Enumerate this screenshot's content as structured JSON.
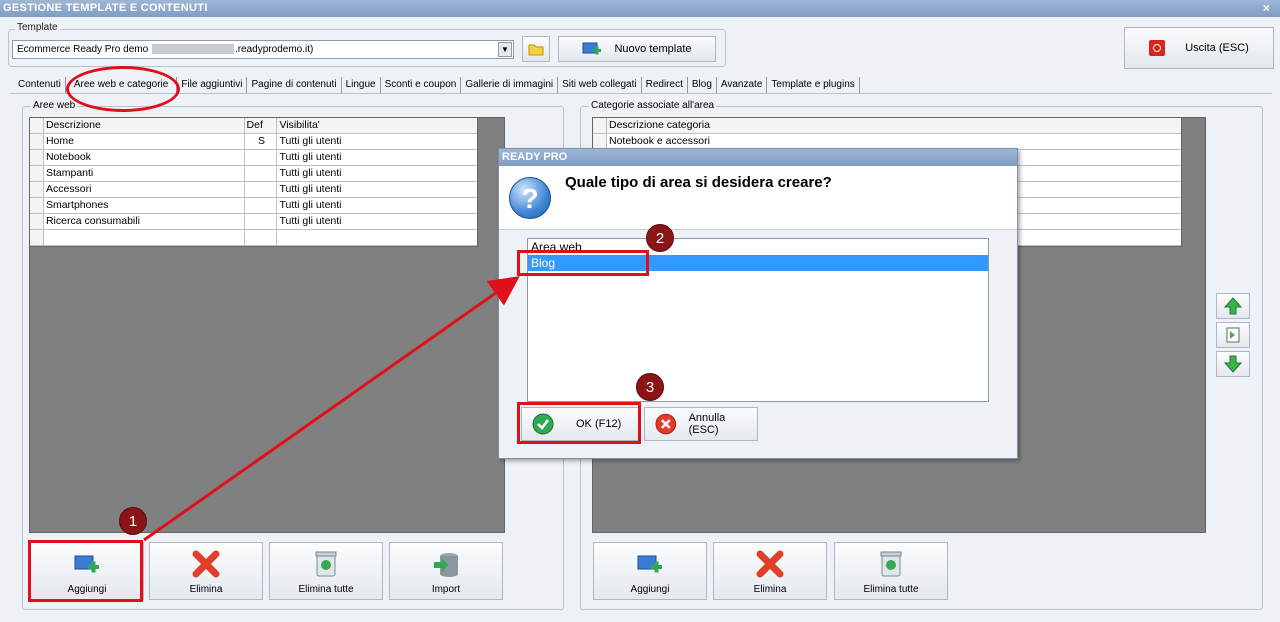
{
  "window": {
    "title": "GESTIONE TEMPLATE E CONTENUTI",
    "close_glyph": "×"
  },
  "template": {
    "legend": "Template",
    "combo_prefix": "Ecommerce Ready Pro demo",
    "combo_suffix": ".readyprodemo.it)",
    "new_label": "Nuovo template"
  },
  "exit_label": "Uscita (ESC)",
  "tabs": [
    {
      "label": "Contenuti"
    },
    {
      "label": "Aree web e categorie",
      "active": true
    },
    {
      "label": "File aggiuntivi"
    },
    {
      "label": "Pagine di contenuti"
    },
    {
      "label": "Lingue"
    },
    {
      "label": "Sconti e coupon"
    },
    {
      "label": "Gallerie di immagini"
    },
    {
      "label": "Siti web collegati"
    },
    {
      "label": "Redirect"
    },
    {
      "label": "Blog"
    },
    {
      "label": "Avanzate"
    },
    {
      "label": "Template e plugins"
    }
  ],
  "left_panel": {
    "legend": "Aree web",
    "columns": [
      "Descrizione",
      "Def",
      "Visibilita'"
    ],
    "rows": [
      [
        "Home",
        "S",
        "Tutti gli utenti"
      ],
      [
        "Notebook",
        "",
        "Tutti gli utenti"
      ],
      [
        "Stampanti",
        "",
        "Tutti gli utenti"
      ],
      [
        "Accessori",
        "",
        "Tutti gli utenti"
      ],
      [
        "Smartphones",
        "",
        "Tutti gli utenti"
      ],
      [
        "Ricerca consumabili",
        "",
        "Tutti gli utenti"
      ],
      [
        "",
        "",
        ""
      ]
    ],
    "buttons": {
      "add": "Aggiungi",
      "delete": "Elimina",
      "delete_all": "Elimina tutte",
      "import": "Import"
    }
  },
  "right_panel": {
    "legend": "Categorie associate all'area",
    "columns": [
      "Descrizione categoria"
    ],
    "rows": [
      [
        "Notebook e accessori"
      ]
    ],
    "buttons": {
      "add": "Aggiungi",
      "delete": "Elimina",
      "delete_all": "Elimina tutte"
    }
  },
  "dialog": {
    "title": "READY PRO",
    "question": "Quale tipo di area si desidera creare?",
    "options": [
      "Area web",
      "Blog"
    ],
    "selected": "Blog",
    "ok_label": "OK (F12)",
    "cancel_label": "Annulla (ESC)"
  },
  "annotations": [
    "1",
    "2",
    "3"
  ],
  "colors": {
    "annotation_red": "#e0101a",
    "selection_blue": "#3399ff",
    "title_blue": "#8aa6cc"
  }
}
